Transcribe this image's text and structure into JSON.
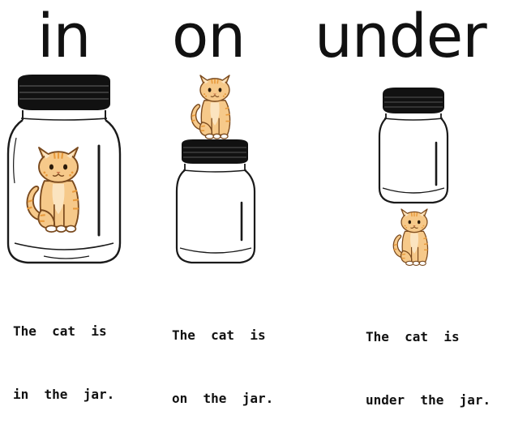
{
  "words": {
    "in": "in",
    "on": "on",
    "under": "under"
  },
  "captions": {
    "in": {
      "line1": "The  cat  is",
      "line2": "in  the  jar."
    },
    "on": {
      "line1": "The  cat  is",
      "line2": "on  the  jar."
    },
    "under": {
      "line1": "The  cat  is",
      "line2": "under  the  jar."
    }
  },
  "colors": {
    "lid": "#111111",
    "jar_outline": "#1a1a1a",
    "cat_fill": "#f6c98a",
    "cat_stripe": "#e89a3c",
    "cat_outline": "#7a4a1e"
  },
  "icons": [
    "jar-icon",
    "cat-icon"
  ]
}
